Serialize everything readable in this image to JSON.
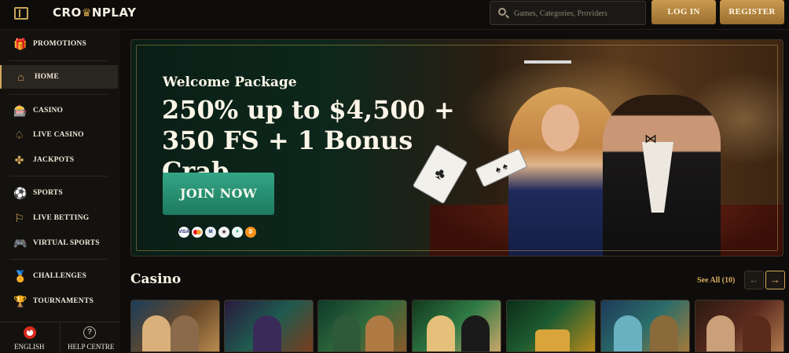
{
  "header": {
    "logo_text": "CROWNPLAY",
    "logo_prefix": "CRO",
    "logo_crown": "♛",
    "logo_suffix": "NPLAY",
    "search_placeholder": "Games, Categories, Providers",
    "login_label": "LOG IN",
    "register_label": "REGISTER"
  },
  "sidebar": {
    "items": [
      {
        "label": "PROMOTIONS",
        "icon": "gift-icon",
        "glyph": "🎁"
      },
      {
        "label": "HOME",
        "icon": "home-icon",
        "glyph": "⌂"
      },
      {
        "label": "CASINO",
        "icon": "slot-machine-icon",
        "glyph": "🎰"
      },
      {
        "label": "LIVE CASINO",
        "icon": "spade-icon",
        "glyph": "♤"
      },
      {
        "label": "JACKPOTS",
        "icon": "clover-icon",
        "glyph": "✤"
      },
      {
        "label": "SPORTS",
        "icon": "ball-icon",
        "glyph": "⚽"
      },
      {
        "label": "LIVE BETTING",
        "icon": "live-icon",
        "glyph": "⚐"
      },
      {
        "label": "VIRTUAL SPORTS",
        "icon": "gamepad-icon",
        "glyph": "🎮"
      },
      {
        "label": "CHALLENGES",
        "icon": "medal-icon",
        "glyph": "🏅"
      },
      {
        "label": "TOURNAMENTS",
        "icon": "trophy-icon",
        "glyph": "🏆"
      }
    ],
    "active": "HOME",
    "language_label": "ENGLISH",
    "help_label": "HELP CENTRE",
    "help_glyph": "?"
  },
  "banner": {
    "subtitle": "Welcome Package",
    "headline": "250% up to $4,500 + 350 FS + 1 Bonus Crab",
    "cta_label": "JOIN NOW",
    "payment_methods": [
      "visa",
      "mastercard",
      "muchbetter",
      "ethereum",
      "tether",
      "bitcoin"
    ],
    "card1_glyph": "♣",
    "card2_glyph": "♠ ♠"
  },
  "casino_section": {
    "title": "Casino",
    "see_all_label": "See All (10)",
    "prev_glyph": "←",
    "next_glyph": "→"
  },
  "colors": {
    "accent_gold": "#d3a75a",
    "cta_green": "#2a9373",
    "background": "#0f0d0b"
  }
}
